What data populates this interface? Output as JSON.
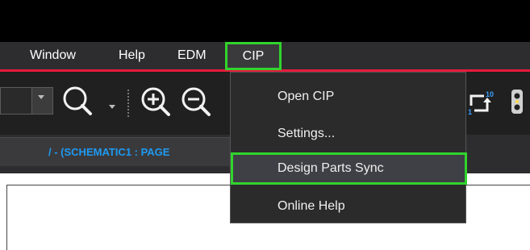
{
  "menubar": {
    "items": [
      "Window",
      "Help",
      "EDM"
    ],
    "cip_label": "CIP"
  },
  "toolbar": {
    "icons": [
      "search-icon",
      "zoom-in-icon",
      "zoom-out-icon",
      "number-sequence-icon"
    ]
  },
  "tab": {
    "label": "/ - (SCHEMATIC1 : PAGE"
  },
  "cip_menu": {
    "items": [
      "Open CIP",
      "Settings...",
      "Design Parts Sync",
      "Online Help"
    ],
    "highlighted_index": 2
  },
  "colors": {
    "accent_red": "#e51b3c",
    "highlight_green": "#31d42c",
    "tab_text_blue": "#1e9af0"
  }
}
